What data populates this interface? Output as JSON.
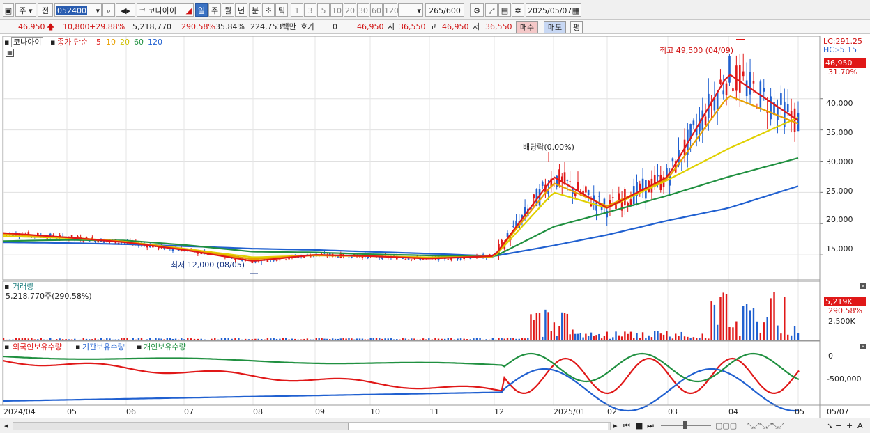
{
  "toolbar": {
    "market_type": "주",
    "scope": "전",
    "code": "052400",
    "stock_name_prefix": "코",
    "stock_name": "코나아이",
    "periods": [
      "일",
      "주",
      "월",
      "년",
      "분",
      "초",
      "틱"
    ],
    "active_period": "일",
    "intervals": [
      "1",
      "3",
      "5",
      "10",
      "20",
      "30",
      "60",
      "120"
    ],
    "count": "265",
    "count_max": "/600",
    "date": "2025/05/07"
  },
  "info": {
    "price": "46,950",
    "change": "10,800",
    "change_pct": "+29.88%",
    "volume": "5,218,770",
    "volume_ratio": "290.58%",
    "turnover": "35.84%",
    "amount": "224,753백만",
    "quote_label": "호가",
    "quote_value": "0",
    "open_price": "46,950",
    "open_label": "시",
    "open_value": "36,550",
    "high_label": "고",
    "high_value": "46,950",
    "low_label": "저",
    "low_value": "36,550",
    "buy_label": "매수",
    "sell_label": "매도",
    "avg_label": "평"
  },
  "price_panel": {
    "stock_label": "코나아이",
    "ma_title": "종가 단순",
    "ma_periods": [
      "5",
      "10",
      "20",
      "60",
      "120"
    ],
    "ma_colors": [
      "#e01818",
      "#e8a000",
      "#e0d000",
      "#209040",
      "#2060d0"
    ],
    "lc": "LC:291.25",
    "hc": "HC:-5.15",
    "last_price": "46,950",
    "last_pct": "31.70%",
    "high_note": "최고 49,500 (04/09)",
    "low_note": "최저 12,000 (08/05)",
    "event_note": "배당락(0.00%)",
    "y_ticks": [
      "40,000",
      "35,000",
      "30,000",
      "25,000",
      "20,000",
      "15,000"
    ]
  },
  "volume_panel": {
    "title": "거래량",
    "value": "5,218,770주(290.58%)",
    "last_value": "5,219K",
    "last_pct": "290.58%",
    "y_ticks": [
      "2,500K"
    ]
  },
  "holdings_panel": {
    "series": [
      "외국인보유수량",
      "기관보유수량",
      "개인보유수량"
    ],
    "colors": [
      "#e01818",
      "#2060d0",
      "#209040"
    ],
    "y_ticks": [
      "0",
      "-500,000"
    ]
  },
  "x_axis": {
    "labels": [
      "2024/04",
      "05",
      "06",
      "07",
      "08",
      "09",
      "10",
      "11",
      "12",
      "2025/01",
      "02",
      "03",
      "04",
      "05"
    ],
    "right_label": "05/07"
  },
  "chart_data": {
    "type": "line",
    "title": "",
    "x": [
      "2024/04",
      "05",
      "06",
      "07",
      "08",
      "09",
      "10",
      "11",
      "12",
      "2025/01",
      "02",
      "03",
      "04",
      "05"
    ],
    "series": [
      {
        "name": "종가 단순 5",
        "values": [
          18500,
          17800,
          17000,
          15800,
          14000,
          15000,
          14800,
          14400,
          14800,
          27500,
          22500,
          27500,
          44000,
          36500
        ]
      },
      {
        "name": "10",
        "values": [
          18300,
          17800,
          17100,
          15900,
          14300,
          15000,
          14800,
          14500,
          14800,
          26500,
          22800,
          27200,
          40500,
          36000
        ]
      },
      {
        "name": "20",
        "values": [
          18000,
          17700,
          17100,
          16000,
          14600,
          14900,
          14800,
          14600,
          14700,
          25000,
          22500,
          27000,
          32000,
          37000
        ]
      },
      {
        "name": "60",
        "values": [
          17200,
          17400,
          17300,
          16600,
          15500,
          15400,
          15100,
          14900,
          14700,
          19500,
          21800,
          24500,
          27500,
          30500
        ]
      },
      {
        "name": "120",
        "values": [
          17000,
          16900,
          16700,
          16400,
          16000,
          15800,
          15500,
          15200,
          14800,
          16500,
          18200,
          20500,
          22500,
          26000
        ]
      }
    ],
    "ylim": [
      11000,
      50000
    ],
    "high": {
      "value": 49500,
      "date": "04/09"
    },
    "low": {
      "value": 12000,
      "date": "08/05"
    }
  }
}
